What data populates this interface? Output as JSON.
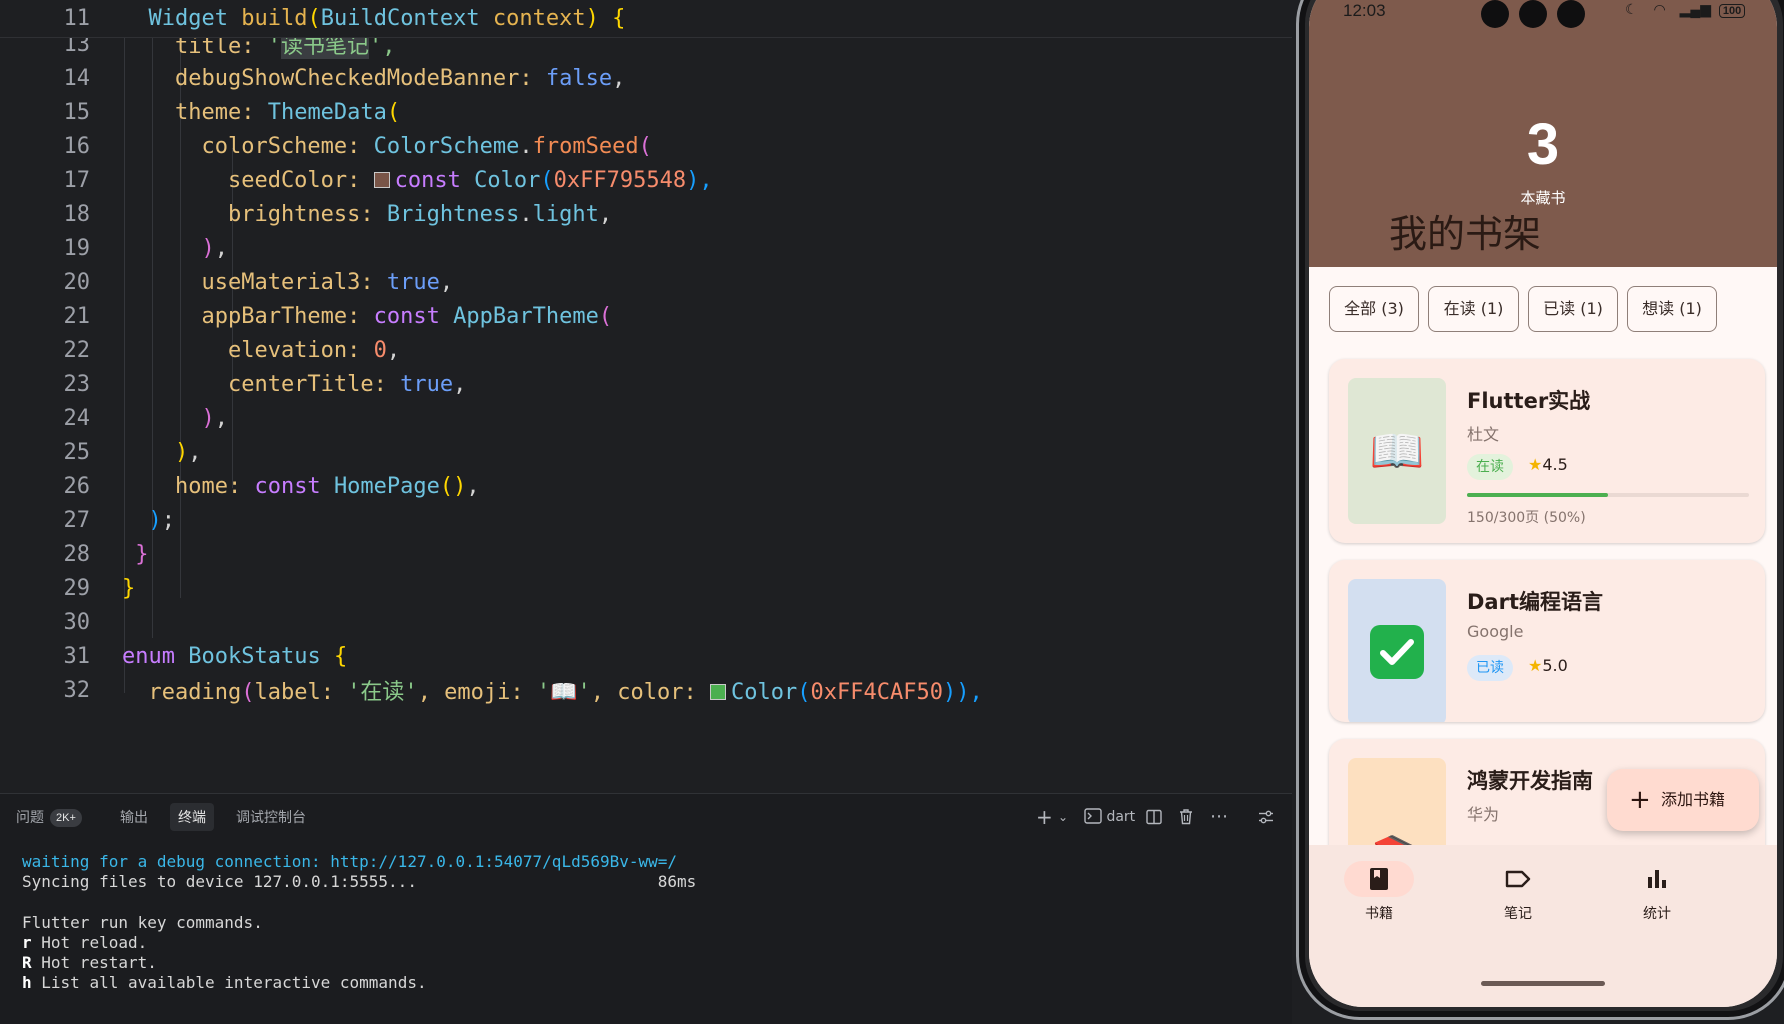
{
  "editor": {
    "sticky_line": {
      "num": "11",
      "tokens": [
        {
          "t": "  ",
          "c": "#d4d4d4"
        },
        {
          "t": "Widget",
          "c": "#6fc3df"
        },
        {
          "t": " ",
          "c": "#d4d4d4"
        },
        {
          "t": "build",
          "c": "#e6b450"
        },
        {
          "t": "(",
          "c": "#ffd700"
        },
        {
          "t": "BuildContext",
          "c": "#6fc3df"
        },
        {
          "t": " context",
          "c": "#e6b450"
        },
        {
          "t": ") {",
          "c": "#ffd700"
        }
      ]
    },
    "lines": [
      {
        "num": "13",
        "tokens": [
          {
            "t": "    title: ",
            "c": "#e6c07b"
          },
          {
            "t": "'",
            "c": "#8bc98a"
          },
          {
            "t": "读书笔记",
            "c": "#8bc98a",
            "bg": "#3a3d41"
          },
          {
            "t": "',",
            "c": "#8bc98a"
          }
        ]
      },
      {
        "num": "14",
        "tokens": [
          {
            "t": "    debugShowCheckedModeBanner: ",
            "c": "#e6c07b"
          },
          {
            "t": "false",
            "c": "#6c9ef8"
          },
          {
            "t": ",",
            "c": "#d4d4d4"
          }
        ]
      },
      {
        "num": "15",
        "tokens": [
          {
            "t": "    theme: ",
            "c": "#e6c07b"
          },
          {
            "t": "ThemeData",
            "c": "#6fc3df"
          },
          {
            "t": "(",
            "c": "#ffd700"
          }
        ]
      },
      {
        "num": "16",
        "tokens": [
          {
            "t": "      colorScheme: ",
            "c": "#e6c07b"
          },
          {
            "t": "ColorScheme",
            "c": "#6fc3df"
          },
          {
            "t": ".",
            "c": "#d4d4d4"
          },
          {
            "t": "fromSeed",
            "c": "#f28b54"
          },
          {
            "t": "(",
            "c": "#da70d6"
          }
        ]
      },
      {
        "num": "17",
        "swatch": "#795548",
        "tokens": [
          {
            "t": "        seedColor: ",
            "c": "#e6c07b"
          },
          {
            "t": "SWATCH",
            "c": "#795548"
          },
          {
            "t": "const ",
            "c": "#c77dff"
          },
          {
            "t": "Color",
            "c": "#6fc3df"
          },
          {
            "t": "(",
            "c": "#179fff"
          },
          {
            "t": "0xFF795548",
            "c": "#f78c6c"
          },
          {
            "t": "),",
            "c": "#179fff"
          }
        ]
      },
      {
        "num": "18",
        "tokens": [
          {
            "t": "        brightness: ",
            "c": "#e6c07b"
          },
          {
            "t": "Brightness",
            "c": "#6fc3df"
          },
          {
            "t": ".",
            "c": "#d4d4d4"
          },
          {
            "t": "light",
            "c": "#6fc3df"
          },
          {
            "t": ",",
            "c": "#d4d4d4"
          }
        ]
      },
      {
        "num": "19",
        "tokens": [
          {
            "t": "      ",
            "c": "#d4d4d4"
          },
          {
            "t": ")",
            "c": "#da70d6"
          },
          {
            "t": ",",
            "c": "#d4d4d4"
          }
        ]
      },
      {
        "num": "20",
        "tokens": [
          {
            "t": "      useMaterial3: ",
            "c": "#e6c07b"
          },
          {
            "t": "true",
            "c": "#6c9ef8"
          },
          {
            "t": ",",
            "c": "#d4d4d4"
          }
        ]
      },
      {
        "num": "21",
        "tokens": [
          {
            "t": "      appBarTheme: ",
            "c": "#e6c07b"
          },
          {
            "t": "const ",
            "c": "#c77dff"
          },
          {
            "t": "AppBarTheme",
            "c": "#6fc3df"
          },
          {
            "t": "(",
            "c": "#da70d6"
          }
        ]
      },
      {
        "num": "22",
        "tokens": [
          {
            "t": "        elevation: ",
            "c": "#e6c07b"
          },
          {
            "t": "0",
            "c": "#f78c6c"
          },
          {
            "t": ",",
            "c": "#d4d4d4"
          }
        ]
      },
      {
        "num": "23",
        "tokens": [
          {
            "t": "        centerTitle: ",
            "c": "#e6c07b"
          },
          {
            "t": "true",
            "c": "#6c9ef8"
          },
          {
            "t": ",",
            "c": "#d4d4d4"
          }
        ]
      },
      {
        "num": "24",
        "tokens": [
          {
            "t": "      ",
            "c": "#d4d4d4"
          },
          {
            "t": ")",
            "c": "#da70d6"
          },
          {
            "t": ",",
            "c": "#d4d4d4"
          }
        ]
      },
      {
        "num": "25",
        "tokens": [
          {
            "t": "    ",
            "c": "#d4d4d4"
          },
          {
            "t": ")",
            "c": "#ffd700"
          },
          {
            "t": ",",
            "c": "#d4d4d4"
          }
        ]
      },
      {
        "num": "26",
        "tokens": [
          {
            "t": "    home: ",
            "c": "#e6c07b"
          },
          {
            "t": "const ",
            "c": "#c77dff"
          },
          {
            "t": "HomePage",
            "c": "#6fc3df"
          },
          {
            "t": "()",
            "c": "#ffd700"
          },
          {
            "t": ",",
            "c": "#d4d4d4"
          }
        ]
      },
      {
        "num": "27",
        "tokens": [
          {
            "t": "  ",
            "c": "#d4d4d4"
          },
          {
            "t": ")",
            "c": "#179fff"
          },
          {
            "t": ";",
            "c": "#d4d4d4"
          }
        ]
      },
      {
        "num": "28",
        "tokens": [
          {
            "t": " ",
            "c": "#d4d4d4"
          },
          {
            "t": "}",
            "c": "#da70d6"
          }
        ]
      },
      {
        "num": "29",
        "tokens": [
          {
            "t": "}",
            "c": "#ffd700"
          }
        ]
      },
      {
        "num": "30",
        "tokens": []
      },
      {
        "num": "31",
        "tokens": [
          {
            "t": "enum ",
            "c": "#c77dff"
          },
          {
            "t": "BookStatus ",
            "c": "#6fc3df"
          },
          {
            "t": "{",
            "c": "#ffd700"
          }
        ]
      },
      {
        "num": "32",
        "swatch": "#4CAF50",
        "tokens": [
          {
            "t": "  reading",
            "c": "#e6c07b"
          },
          {
            "t": "(",
            "c": "#da70d6"
          },
          {
            "t": "label: ",
            "c": "#e6c07b"
          },
          {
            "t": "'在读'",
            "c": "#8bc98a"
          },
          {
            "t": ", emoji: ",
            "c": "#e6c07b"
          },
          {
            "t": "'📖'",
            "c": "#8bc98a"
          },
          {
            "t": ", color: ",
            "c": "#e6c07b"
          },
          {
            "t": "SWATCH",
            "c": "#4CAF50"
          },
          {
            "t": "Color",
            "c": "#6fc3df"
          },
          {
            "t": "(",
            "c": "#179fff"
          },
          {
            "t": "0xFF4CAF50",
            "c": "#f78c6c"
          },
          {
            "t": ")),",
            "c": "#179fff"
          }
        ]
      }
    ]
  },
  "panel": {
    "tabs": [
      {
        "label": "问题",
        "badge": "2K+"
      },
      {
        "label": "输出"
      },
      {
        "label": "终端",
        "active": true
      },
      {
        "label": "调试控制台"
      }
    ],
    "toolbar": {
      "add": "+",
      "dropdown": "⌄",
      "terminal_label": "dart"
    },
    "terminal": [
      {
        "text": "waiting for a debug connection: http://127.0.0.1:54077/qLd569Bv-ww=/",
        "kind": "link"
      },
      {
        "text": "Syncing files to device 127.0.0.1:5555...                         86ms",
        "kind": "plain"
      },
      {
        "text": "",
        "kind": "plain"
      },
      {
        "text": "Flutter run key commands.",
        "kind": "plain"
      },
      {
        "key": "r",
        "text": " Hot reload.",
        "kind": "cmd"
      },
      {
        "key": "R",
        "text": " Hot restart.",
        "kind": "cmd"
      },
      {
        "key": "h",
        "text": " List all available interactive commands.",
        "kind": "cmd"
      }
    ]
  },
  "phone": {
    "status_time": "12:03",
    "battery": "100",
    "book_count": "3",
    "book_count_label": "本藏书",
    "shelf_title": "我的书架",
    "chips": [
      "全部 (3)",
      "在读 (1)",
      "已读 (1)",
      "想读 (1)"
    ],
    "books": [
      {
        "title": "Flutter实战",
        "author": "杜文",
        "status": "在读",
        "status_color": "#4caf50",
        "status_bg": "#e3f2dc",
        "rating": "4.5",
        "cover_color": "#dfe7d4",
        "cover_emoji": "📖",
        "progress": 0.5,
        "progress_text": "150/300页 (50%)"
      },
      {
        "title": "Dart编程语言",
        "author": "Google",
        "status": "已读",
        "status_color": "#2196f3",
        "status_bg": "#dde9f8",
        "rating": "5.0",
        "cover_color": "#d3dff0",
        "cover_emoji": "✅"
      },
      {
        "title": "鸿蒙开发指南",
        "author": "华为",
        "cover_color": "#fde0c0",
        "cover_emoji": "📚"
      }
    ],
    "fab_label": "添加书籍",
    "nav": [
      {
        "label": "书籍",
        "icon": "book-icon",
        "active": true
      },
      {
        "label": "笔记",
        "icon": "label-icon"
      },
      {
        "label": "统计",
        "icon": "bar-chart-icon"
      }
    ]
  }
}
